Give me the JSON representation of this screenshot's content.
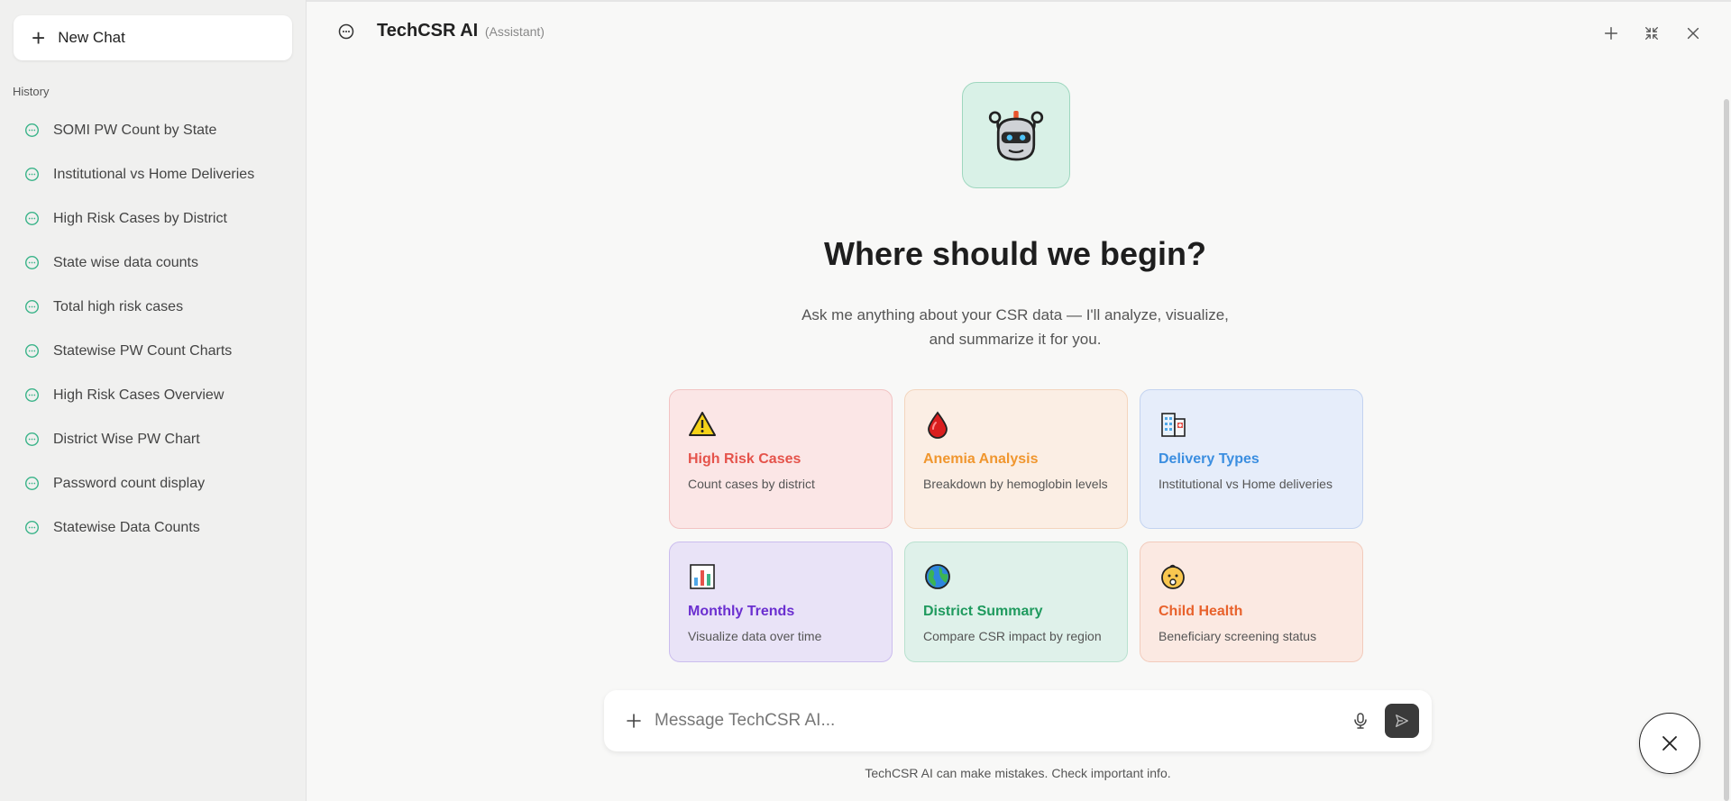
{
  "sidebar": {
    "new_chat_label": "New Chat",
    "history_title": "History",
    "items": [
      {
        "label": "SOMI PW Count by State"
      },
      {
        "label": "Institutional vs Home Deliveries"
      },
      {
        "label": "High Risk Cases by District"
      },
      {
        "label": "State wise data counts"
      },
      {
        "label": "Total high risk cases"
      },
      {
        "label": "Statewise PW Count Charts"
      },
      {
        "label": "High Risk Cases Overview"
      },
      {
        "label": "District Wise PW Chart"
      },
      {
        "label": "Password count display"
      },
      {
        "label": "Statewise Data Counts"
      }
    ]
  },
  "header": {
    "title": "TechCSR AI",
    "subtitle": "(Assistant)"
  },
  "main": {
    "headline": "Where should we begin?",
    "subline": "Ask me anything about your CSR data — I'll analyze, visualize, and summarize it for you.",
    "cards": [
      {
        "title": "High Risk Cases",
        "desc": "Count cases by district",
        "icon": "warning-icon",
        "title_color": "#e5534b"
      },
      {
        "title": "Anemia Analysis",
        "desc": "Breakdown by hemoglobin levels",
        "icon": "blood-drop-icon",
        "title_color": "#f0962e"
      },
      {
        "title": "Delivery Types",
        "desc": "Institutional vs Home deliveries",
        "icon": "hospital-icon",
        "title_color": "#3b8ee0"
      },
      {
        "title": "Monthly Trends",
        "desc": "Visualize data over time",
        "icon": "bar-chart-icon",
        "title_color": "#6b2fd0"
      },
      {
        "title": "District Summary",
        "desc": "Compare CSR impact by region",
        "icon": "globe-icon",
        "title_color": "#1f9a5e"
      },
      {
        "title": "Child Health",
        "desc": "Beneficiary screening status",
        "icon": "baby-icon",
        "title_color": "#e8622c"
      }
    ]
  },
  "input": {
    "placeholder": "Message TechCSR AI...",
    "disclaimer": "TechCSR AI can make mistakes. Check important info."
  },
  "colors": {
    "accent_green": "#3cb48a",
    "sidebar_bg": "#f0f0ef",
    "page_bg": "#f8f8f7"
  }
}
